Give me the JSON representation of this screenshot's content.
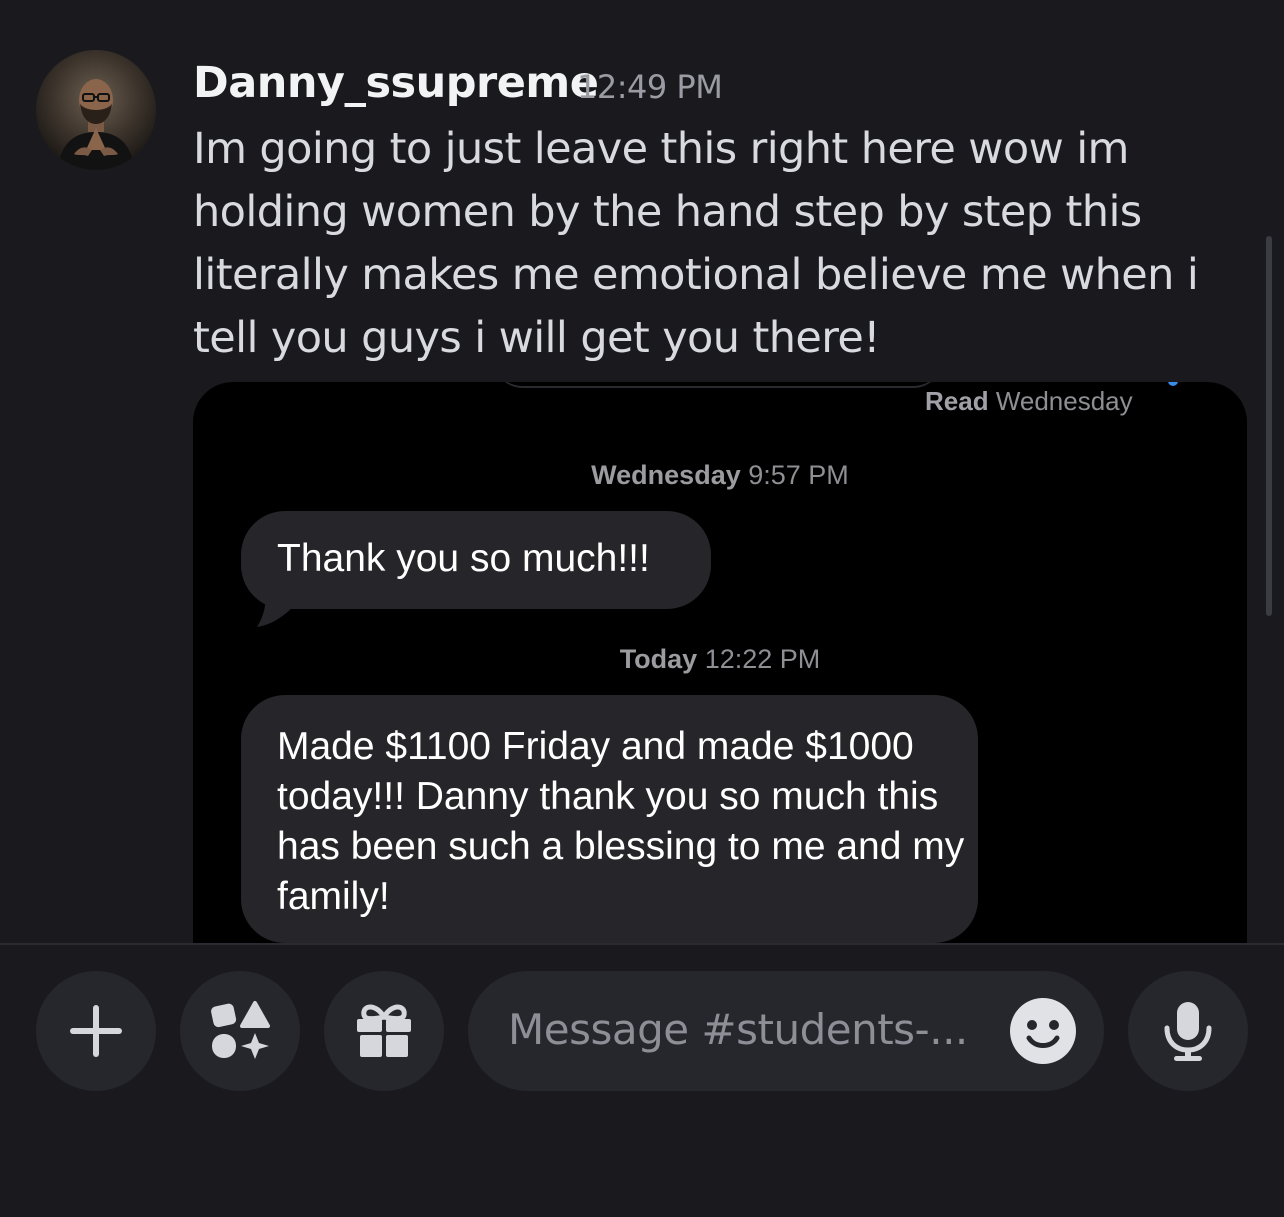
{
  "message": {
    "username": "Danny_ssupreme",
    "timestamp": "12:49 PM",
    "text": "Im going to just leave this right here wow im holding women by the hand step by step this literally makes me emotional believe me when i tell you guys i will get you there!"
  },
  "screenshot": {
    "read_label": "Read",
    "read_day": "Wednesday",
    "ts1_day": "Wednesday",
    "ts1_time": "9:57 PM",
    "bubble1": "Thank you so much!!!",
    "ts2_day": "Today",
    "ts2_time": "12:22 PM",
    "bubble2": "Made $1100 Friday and made $1000 today!!! Danny thank you so much this has been such a blessing to me and my family!"
  },
  "composer": {
    "placeholder": "Message #students-..."
  },
  "icons": {
    "add": "plus-icon",
    "apps": "apps-icon",
    "gift": "gift-icon",
    "emoji": "emoji-icon",
    "mic": "microphone-icon"
  },
  "colors": {
    "background": "#1a1a1e",
    "bubble": "#26252a",
    "accent": "#3a8ce6"
  }
}
